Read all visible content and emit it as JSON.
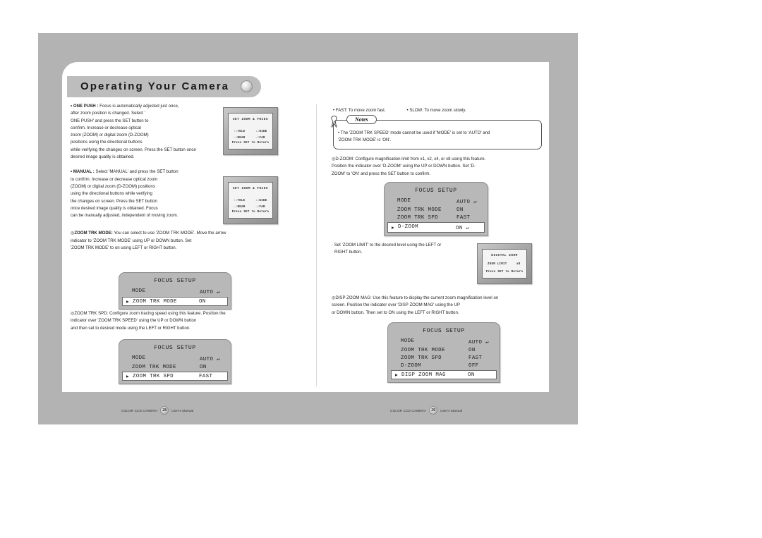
{
  "header": {
    "title": "Operating Your Camera",
    "dot_icon": "circle-ornament-icon"
  },
  "left_column": {
    "one_push": {
      "label": "• ONE PUSH :",
      "lines": [
        "Focus is automatically adjusted just once,",
        "after zoom position is changed. Select '",
        "ONE PUSH' and press the SET button to",
        "confirm. Increase or decrease optical",
        "zoom (ZOOM) or digital zoom (D-ZOOM)",
        "positions using the directional buttons",
        "while verifying the changes on screen. Press the SET button once",
        "desired image quality is obtained."
      ]
    },
    "manual": {
      "label": "• MANUAL :",
      "lines": [
        "Select 'MANUAL' and press the SET button",
        "to confirm. Increase or decrease optical zoom",
        "(ZOOM) or digital zoom (D-ZOOM) positions",
        "using the directional buttons while verifying",
        "the changes on screen. Press the SET button",
        "once desired image quality is obtained. Focus",
        "can be manually adjusted, independent of moving zoom."
      ]
    },
    "zoom_trk_mode": {
      "label": "ZOOM TRK MODE:",
      "bullet_icon": "open-circle-bullet-icon",
      "lines": [
        "You can select to use 'ZOOM TRK MODE'. Move the arrow",
        "indicator to 'ZOOM TRK MODE' using UP or DOWN button. Set",
        "'ZOOM TRK MODE' to on using LEFT or RIGHT button."
      ]
    },
    "zoom_trk_spd": {
      "label": "ZOOM TRK SPD:",
      "bullet_icon": "open-circle-bullet-icon",
      "lines": [
        "Configure zoom tracing speed using this feature. Position the",
        "indicator over 'ZOOM TRK SPEED' using the UP or DOWN button",
        "and then set to desired mode using the LEFT or RIGHT button."
      ]
    }
  },
  "right_column": {
    "fast": {
      "label": "• FAST:",
      "text": "To move zoom fast."
    },
    "slow": {
      "label": "• SLOW:",
      "text": "To move zoom slowly."
    },
    "notes": {
      "tab_label": "Notes",
      "pin_icon": "push-pin-icon",
      "lines": [
        "• The 'ZOOM TRK SPEED' mode cannot be used if 'MODE' is set to 'AUTO' and",
        "'ZOOM TRK MODE' is 'ON'."
      ]
    },
    "d_zoom": {
      "label": "D-ZOOM:",
      "bullet_icon": "open-circle-bullet-icon",
      "lines": [
        "Configure magnification limit from x1, x2, x4, or x8 using this feature.",
        "Position the indicator over 'D-ZOOM' using the UP or DOWN button. Set 'D-",
        "ZOOM' to 'ON' and press the SET button to confirm."
      ]
    },
    "zoom_limit_note": {
      "lines": [
        "· Set 'ZOOM LIMIT' to the desired level using the LEFT or",
        "RIGHT button."
      ]
    },
    "disp_zoom_mag": {
      "label": "DISP ZOOM MAG:",
      "bullet_icon": "open-circle-bullet-icon",
      "lines": [
        "Use this feature to display the current zoom magnification level on",
        "screen. Position the indicator over 'DISP ZOOM MAG' using the UP",
        "or DOWN button. Then set to ON using the LEFT or RIGHT button."
      ]
    }
  },
  "osd_screens": {
    "set_zoom_focus_1": {
      "title": "SET ZOOM & FOCUS",
      "row_tele": "↑:TELE",
      "row_wide": "↓:WIDE",
      "row_near": "←:NEAR",
      "row_far": "→:FAR",
      "footer": "Press SET to Return"
    },
    "set_zoom_focus_2": {
      "title": "SET ZOOM & FOCUS",
      "row_tele": "↑:TELE",
      "row_wide": "↓:WIDE",
      "row_near": "←:NEAR",
      "row_far": "→:FAR",
      "footer": "Press SET to Return"
    },
    "digital_zoom": {
      "title": "DIGITAL ZOOM",
      "limit_label": "ZOOM LIMIT",
      "limit_value": "x8",
      "footer": "Press SET to Return"
    }
  },
  "menus": {
    "focus_setup_1": {
      "title": "FOCUS SETUP",
      "rows": [
        {
          "label": "MODE",
          "value": "AUTO ↵",
          "selected": false
        },
        {
          "label": "ZOOM TRK MODE",
          "value": "ON",
          "selected": true
        }
      ]
    },
    "focus_setup_2": {
      "title": "FOCUS SETUP",
      "rows": [
        {
          "label": "MODE",
          "value": "AUTO ↵",
          "selected": false
        },
        {
          "label": "ZOOM TRK MODE",
          "value": "ON",
          "selected": false
        },
        {
          "label": "ZOOM TRK SPD",
          "value": "FAST",
          "selected": true
        }
      ]
    },
    "focus_setup_3": {
      "title": "FOCUS SETUP",
      "rows": [
        {
          "label": "MODE",
          "value": "AUTO ↵",
          "selected": false
        },
        {
          "label": "ZOOM TRK MODE",
          "value": "ON",
          "selected": false
        },
        {
          "label": "ZOOM TRK SPD",
          "value": "FAST",
          "selected": false
        },
        {
          "label": "D-ZOOM",
          "value": "ON ↵",
          "selected": true
        }
      ]
    },
    "focus_setup_4": {
      "title": "FOCUS SETUP",
      "rows": [
        {
          "label": "MODE",
          "value": "AUTO ↵",
          "selected": false
        },
        {
          "label": "ZOOM TRK MODE",
          "value": "ON",
          "selected": false
        },
        {
          "label": "ZOOM TRK SPD",
          "value": "FAST",
          "selected": false
        },
        {
          "label": "D-ZOOM",
          "value": "OFF",
          "selected": false
        },
        {
          "label": "DISP ZOOM MAG",
          "value": "ON",
          "selected": true
        }
      ]
    }
  },
  "footers": {
    "left": {
      "brand": "COLOR CCD CAMERA",
      "page": "28",
      "manual": "User's Manual"
    },
    "right": {
      "brand": "COLOR CCD CAMERA",
      "page": "29",
      "manual": "User's Manual"
    }
  },
  "colors": {
    "backdrop": "#b3b3b3",
    "header_bar": "#bdbdbd",
    "menu_bg": "#b8b8b8",
    "sheet": "#ffffff"
  }
}
